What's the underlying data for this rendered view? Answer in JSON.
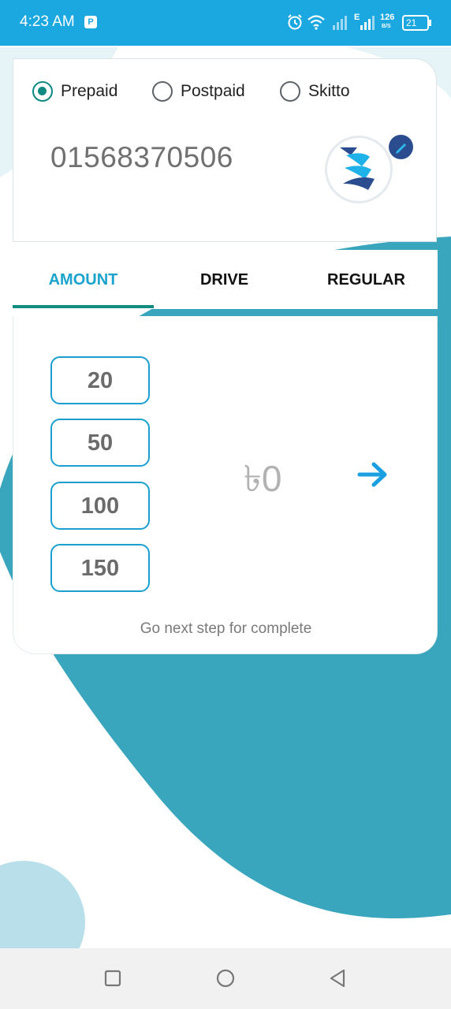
{
  "status_bar": {
    "time": "4:23 AM",
    "app_icon": "P",
    "net_speed": "126",
    "net_speed_unit": "B/S",
    "network_type": "E",
    "battery": "21",
    "icons": [
      "alarm-icon",
      "wifi-icon",
      "signal-icon",
      "signal-icon",
      "battery-icon"
    ]
  },
  "sim_type": {
    "options": [
      {
        "label": "Prepaid",
        "checked": true
      },
      {
        "label": "Postpaid",
        "checked": false
      },
      {
        "label": "Skitto",
        "checked": false
      }
    ]
  },
  "recipient": {
    "phone": "01568370506",
    "operator_icon": "operator-logo",
    "edit_icon": "pencil-icon"
  },
  "tabs": [
    {
      "label": "AMOUNT",
      "active": true
    },
    {
      "label": "DRIVE",
      "active": false
    },
    {
      "label": "REGULAR",
      "active": false
    }
  ],
  "amount": {
    "quick_amounts": [
      "20",
      "50",
      "100",
      "150"
    ],
    "display": "৳0",
    "next_icon": "arrow-right-icon",
    "hint": "Go next step for complete"
  },
  "nav": {
    "icons": [
      "recent-apps-icon",
      "home-icon",
      "back-icon"
    ]
  },
  "colors": {
    "status_bar": "#1ba8e0",
    "accent": "#1aa3cc",
    "radio_checked": "#0e8a82",
    "background_blob": "#3aa6bd"
  }
}
